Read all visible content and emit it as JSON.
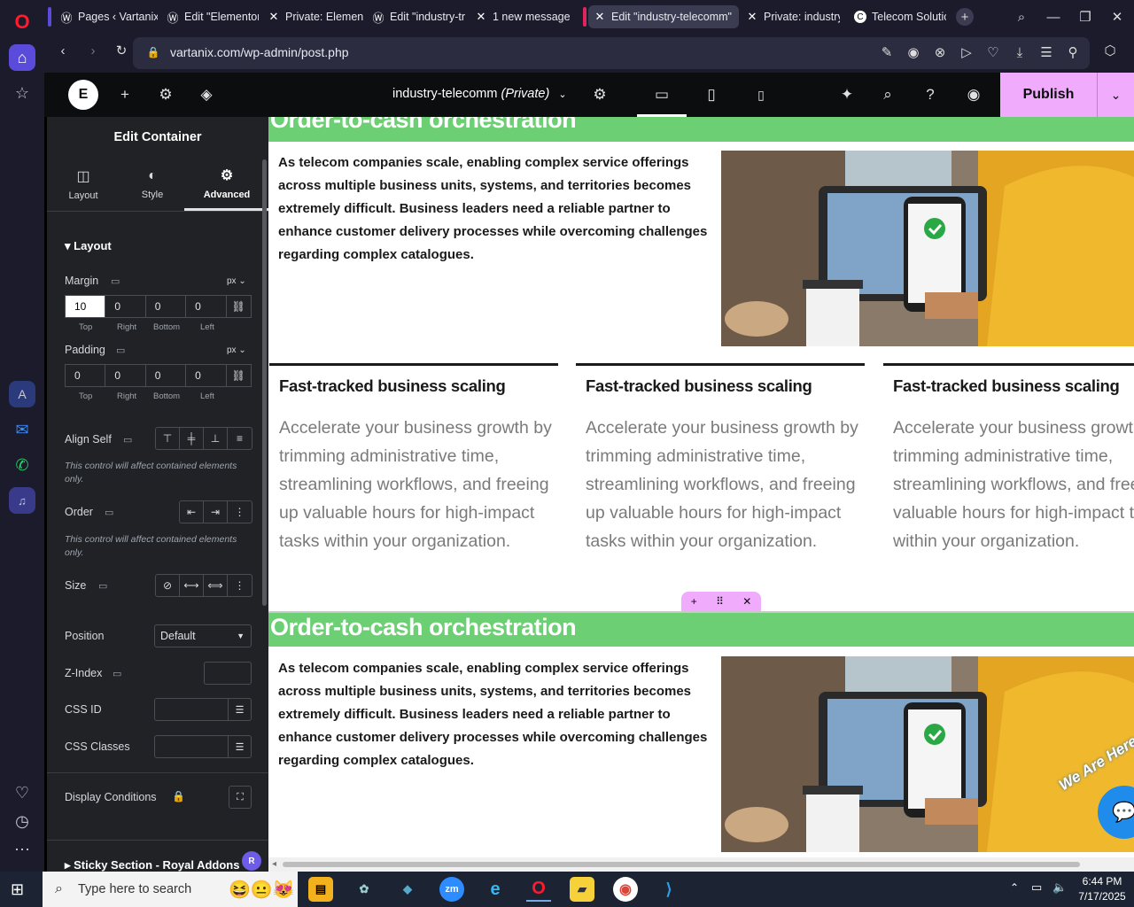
{
  "browser": {
    "tabs": [
      {
        "label": "Pages ‹ Vartanix"
      },
      {
        "label": "Edit \"Elementor"
      },
      {
        "label": "Private: Element"
      },
      {
        "label": "Edit \"industry-tr"
      },
      {
        "label": "1 new message"
      },
      {
        "label": "Edit \"industry-telecomm\""
      },
      {
        "label": "Private: industry"
      },
      {
        "label": "Telecom Solutio"
      }
    ],
    "url": "vartanix.com/wp-admin/post.php"
  },
  "elementor": {
    "page_name": "industry-telecomm",
    "page_status": "(Private)",
    "publish_label": "Publish"
  },
  "panel": {
    "title": "Edit Container",
    "tabs": [
      {
        "label": "Layout",
        "icon": "layout-icon"
      },
      {
        "label": "Style",
        "icon": "style-icon"
      },
      {
        "label": "Advanced",
        "icon": "gear-icon"
      }
    ],
    "section_title": "Layout",
    "margin": {
      "label": "Margin",
      "unit": "px",
      "top": "10",
      "right": "0",
      "bottom": "0",
      "left": "0"
    },
    "padding": {
      "label": "Padding",
      "unit": "px",
      "top": "0",
      "right": "0",
      "bottom": "0",
      "left": "0"
    },
    "dim_labels": {
      "top": "Top",
      "right": "Right",
      "bottom": "Bottom",
      "left": "Left"
    },
    "align_self": {
      "label": "Align Self",
      "note": "This control will affect contained elements only."
    },
    "order": {
      "label": "Order",
      "note": "This control will affect contained elements only."
    },
    "size": {
      "label": "Size"
    },
    "position": {
      "label": "Position",
      "value": "Default"
    },
    "z_index": {
      "label": "Z-Index"
    },
    "css_id": {
      "label": "CSS ID"
    },
    "css_classes": {
      "label": "CSS Classes"
    },
    "display_conditions": {
      "label": "Display Conditions"
    },
    "sticky_section": {
      "label": "Sticky Section - Royal Addons"
    }
  },
  "canvas": {
    "section_heading": "Order-to-cash orchestration",
    "intro": "As telecom companies scale, enabling complex service offerings across multiple business units, systems, and territories becomes extremely difficult. Business leaders need a reliable partner to enhance customer delivery processes while overcoming challenges regarding complex catalogues.",
    "columns": [
      {
        "title": "Fast-tracked business scaling",
        "body": "Accelerate your business growth by trimming administrative time, streamlining workflows, and freeing up valuable hours for high-impact tasks within your organization."
      },
      {
        "title": "Fast-tracked business scaling",
        "body": "Accelerate your business growth by trimming administrative time, streamlining workflows, and freeing up valuable hours for high-impact tasks within your organization."
      },
      {
        "title": "Fast-tracked business scaling",
        "body": "Accelerate your business growth by trimming administrative time, streamlining workflows, and freeing up valuable hours for high-impact tasks within your organization."
      }
    ],
    "chat_widget_text": "We Are Here"
  },
  "taskbar": {
    "search_placeholder": "Type here to search",
    "time": "6:44 PM",
    "date": "7/17/2025"
  },
  "colors": {
    "accent_pink": "#f0abfc",
    "green_band": "#6ccf74",
    "panel_bg": "#202226"
  }
}
